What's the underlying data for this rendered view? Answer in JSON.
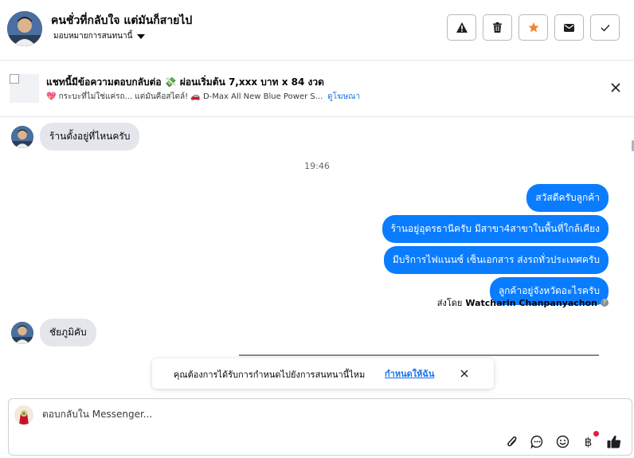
{
  "header": {
    "title": "คนชั่วที่กลับใจ แต่มันก็สายไป",
    "assignment": "มอบหมายการสนทนานี้",
    "buttons": [
      {
        "name": "spam-button",
        "icon": "warning-icon"
      },
      {
        "name": "delete-button",
        "icon": "trash-icon"
      },
      {
        "name": "star-button",
        "icon": "star-icon"
      },
      {
        "name": "mark-unread-button",
        "icon": "envelope-icon"
      },
      {
        "name": "mark-done-button",
        "icon": "check-icon"
      }
    ]
  },
  "ad": {
    "title": "แชทนี้มีข้อความตอบกลับต่อ 💸 ผ่อนเริ่มต้น 7,xxx บาท x 84 งวด",
    "subtitle": "💖 กระบะที่ไม่ใช่แค่รถ... แต่มันคือสไตล์! 🚗 D-Max All New Blue Power S...",
    "link": "ดูโฆษณา"
  },
  "chat": {
    "messages_in": [
      {
        "text": "ร้านตั้งอยู่ที่ไหนครับ"
      },
      {
        "text": "ชัยภูมิคับ"
      }
    ],
    "timestamp": "19:46",
    "messages_out": [
      {
        "text": "สวัสดีครับลูกค้า"
      },
      {
        "text": "ร้านอยู่อุดรธานีครับ มีสาขา4สาขาในพื้นที่ใกล้เคียง"
      },
      {
        "text": "มีบริการไฟแนนซ์ เซ็นเอกสาร ส่งรถทั่วประเทศครับ"
      },
      {
        "text": "ลูกค้าอยู่จังหวัดอะไรครับ"
      }
    ],
    "sent_by_prefix": "ส่งโดย",
    "sent_by_name": "Watcharin Chanpanyachon"
  },
  "toast": {
    "text": "คุณต้องการได้รับการกำหนดไปยังการสนทนานี้ไหม",
    "link": "กำหนดให้ฉัน"
  },
  "composer": {
    "placeholder": "ตอบกลับใน Messenger...",
    "tools": [
      "attach-icon",
      "quick-reply-icon",
      "emoji-icon",
      "payment-baht-icon",
      "thumbs-up-icon"
    ],
    "baht_symbol": "฿"
  },
  "colors": {
    "accent": "#0a7cff",
    "star": "#f5842a",
    "link": "#1a73e8",
    "incoming_bubble": "#e4e6eb"
  }
}
